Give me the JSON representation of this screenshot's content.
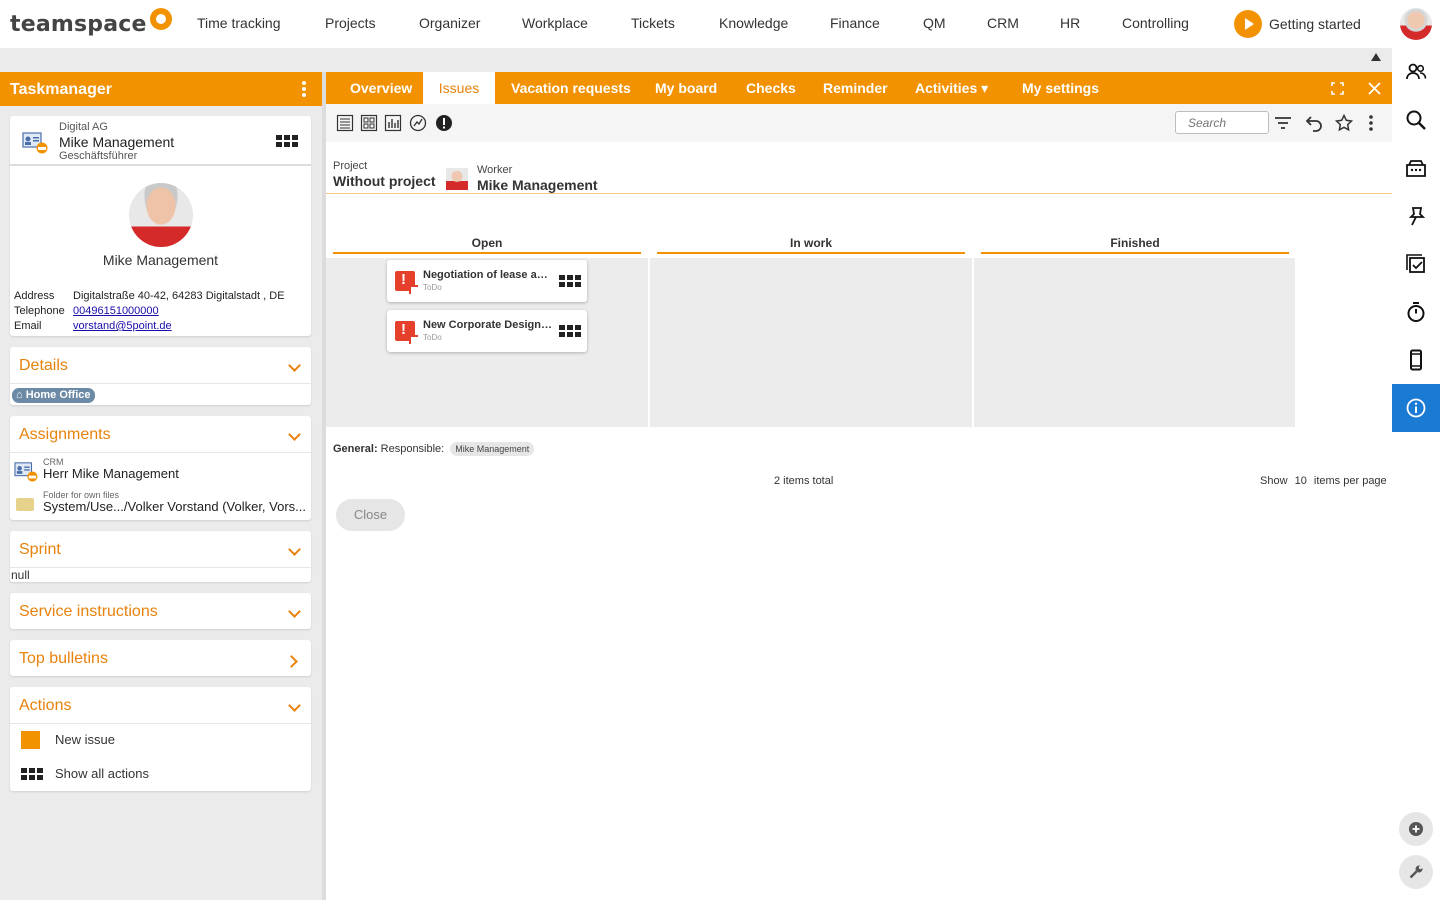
{
  "app": {
    "logo_text": "teamspace"
  },
  "top_nav": {
    "items": [
      "Time tracking",
      "Projects",
      "Organizer",
      "Workplace",
      "Tickets",
      "Knowledge",
      "Finance",
      "QM",
      "CRM",
      "HR",
      "Controlling"
    ],
    "getting_started": "Getting started"
  },
  "left": {
    "header_title": "Taskmanager",
    "contact": {
      "company": "Digital AG",
      "name": "Mike Management",
      "role": "Geschäftsführer",
      "display_name": "Mike Management",
      "address_label": "Address",
      "address": "Digitalstraße 40-42, 64283 Digitalstadt , DE",
      "telephone_label": "Telephone",
      "telephone": "00496151000000",
      "email_label": "Email",
      "email": "vorstand@5point.de"
    },
    "details": {
      "title": "Details",
      "badge": "Home Office"
    },
    "assignments": {
      "title": "Assignments",
      "crm_label": "CRM",
      "crm_value": "Herr Mike Management",
      "folder_label": "Folder for own files",
      "folder_value": "System/Use.../Volker Vorstand (Volker, Vors..."
    },
    "sprint": {
      "title": "Sprint",
      "value": "null"
    },
    "service_instructions": {
      "title": "Service instructions"
    },
    "top_bulletins": {
      "title": "Top bulletins"
    },
    "actions": {
      "title": "Actions",
      "new_issue": "New issue",
      "show_all": "Show all actions"
    }
  },
  "main": {
    "tabs": [
      "Overview",
      "Issues",
      "Vacation requests",
      "My board",
      "Checks",
      "Reminder",
      "Activities ▾",
      "My settings"
    ],
    "active_tab": "Issues",
    "search_placeholder": "Search",
    "filters": {
      "project_label": "Project",
      "project_value": "Without project",
      "worker_label": "Worker",
      "worker_value": "Mike Management"
    },
    "columns": [
      "Open",
      "In work",
      "Finished"
    ],
    "cards": [
      {
        "title": "Negotiation of lease agr...",
        "status": "ToDo"
      },
      {
        "title": "New Corporate Design C...",
        "status": "ToDo"
      }
    ],
    "general_label": "General:",
    "responsible_label": "Responsible:",
    "responsible_value": "Mike Management",
    "items_total": "2 items total",
    "show_label": "Show",
    "per_page": "10",
    "per_page_suffix": "items per page",
    "close_label": "Close"
  },
  "colors": {
    "accent": "#f39200",
    "active_rail": "#1a7ad4",
    "issue_red": "#e4402b"
  }
}
